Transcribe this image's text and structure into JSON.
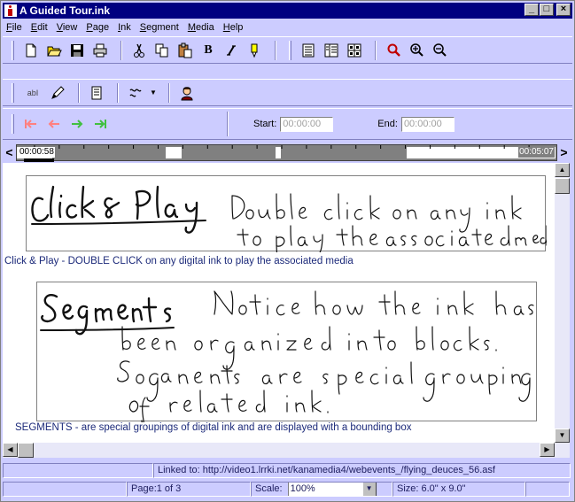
{
  "window": {
    "title": "A Guided Tour.ink"
  },
  "menu": [
    "File",
    "Edit",
    "View",
    "Page",
    "Ink",
    "Segment",
    "Media",
    "Help"
  ],
  "toolbar_main": {
    "bold_label": "B",
    "icons": [
      "new-doc-icon",
      "open-folder-icon",
      "save-icon",
      "print-icon",
      "cut-icon",
      "copy-icon",
      "paste-icon",
      "bold-icon",
      "italic-icon",
      "highlight-icon",
      "view-single-icon",
      "view-split-icon",
      "view-grid-icon",
      "find-icon",
      "zoom-in-icon",
      "zoom-out-icon"
    ]
  },
  "toolbar_ink": {
    "text_tool_label": "abI",
    "icons": [
      "text-select-icon",
      "pen-icon",
      "notes-icon",
      "ink-style-icon",
      "dropdown-icon",
      "user-icon"
    ]
  },
  "toolbar_media": {
    "start_label": "Start:",
    "start_value": "00:00:00",
    "end_label": "End:",
    "end_value": "00:00:00"
  },
  "timeline": {
    "current_time": "00:00:58",
    "end_time": "00:05:07"
  },
  "document": {
    "blocks": [
      {
        "ink_title": "Click & Play",
        "ink_lines": [
          "Double click on any ink",
          "to play the associated media"
        ],
        "caption": "Click & Play - DOUBLE CLICK on any digital ink to play the associated media"
      },
      {
        "ink_title": "Segments",
        "ink_lines": [
          "Notice how the ink has",
          "been organized into blocks.",
          "Segments are special groupings",
          "of related ink."
        ],
        "caption": "SEGMENTS - are special groupings of digital ink and are displayed with a bounding box"
      }
    ]
  },
  "status": {
    "link_text": "Linked to: http://video1.lrrki.net/kanamedia4/webevents_/flying_deuces_56.asf",
    "page": "Page:1 of 3",
    "scale_label": "Scale:",
    "scale_value": "100%",
    "size": "Size: 6.0\" x 9.0\""
  },
  "colors": {
    "chrome": "#ccccff",
    "titlebar": "#000080",
    "caption_text": "#1c2a7a"
  }
}
